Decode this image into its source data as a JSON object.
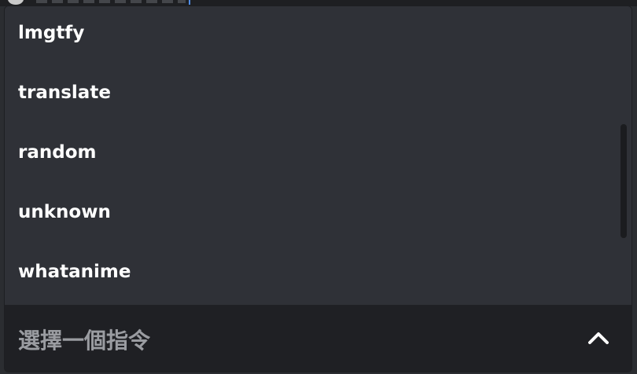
{
  "command_menu": {
    "items": [
      {
        "label": "lmgtfy"
      },
      {
        "label": "translate"
      },
      {
        "label": "random"
      },
      {
        "label": "unknown"
      },
      {
        "label": "whatanime"
      }
    ]
  },
  "select": {
    "placeholder": "選擇一個指令",
    "chevron_icon": "chevron-up-icon"
  },
  "colors": {
    "menu_bg": "#2f3137",
    "select_bg": "#1f2024",
    "item_text": "#ffffff",
    "placeholder_text": "#9a9ca1"
  }
}
